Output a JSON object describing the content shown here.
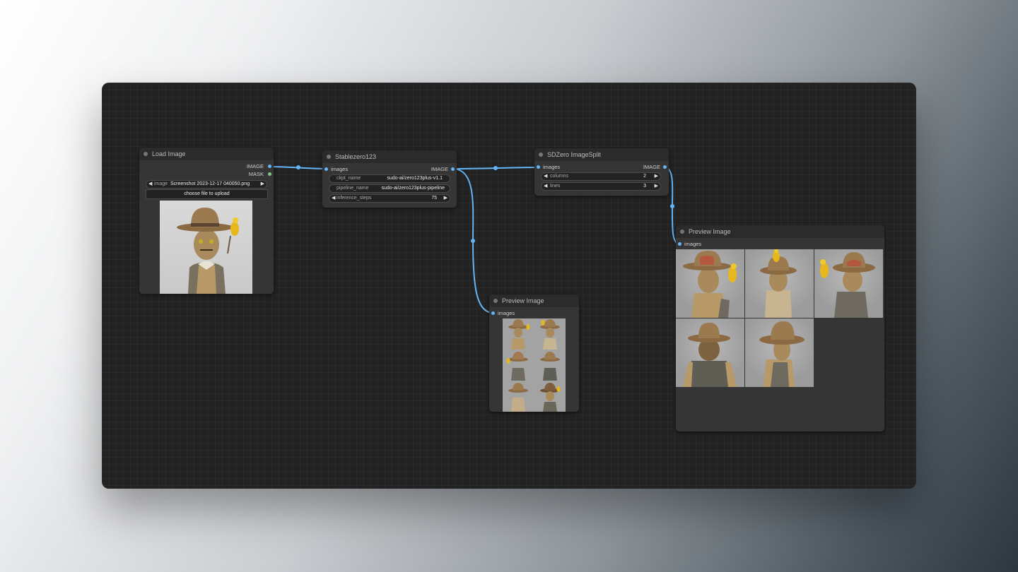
{
  "nodes": {
    "load_image": {
      "title": "Load Image",
      "outputs": [
        "IMAGE",
        "MASK"
      ],
      "image_widget": {
        "label": "image",
        "value": "Screenshot 2023-12-17 040050.png"
      },
      "upload_label": "choose file to upload"
    },
    "stablezero": {
      "title": "Stablezero123",
      "input": "images",
      "output": "IMAGE",
      "widgets": [
        {
          "label": "ckpt_name",
          "value": "sudo-ai/zero123plus-v1.1"
        },
        {
          "label": "pipeline_name",
          "value": "sudo-ai/zero123plus-pipeline"
        },
        {
          "label": "inference_steps",
          "value": "75"
        }
      ]
    },
    "imagesplit": {
      "title": "SDZero ImageSplit",
      "input": "images",
      "output": "IMAGE",
      "widgets": [
        {
          "label": "columns",
          "value": "2"
        },
        {
          "label": "lines",
          "value": "3"
        }
      ]
    },
    "preview_small": {
      "title": "Preview Image",
      "input": "images"
    },
    "preview_large": {
      "title": "Preview Image",
      "input": "images"
    }
  },
  "colors": {
    "wire": "#64b5f6",
    "mask_port": "#81c784",
    "node_bg": "#353535",
    "canvas_bg": "#222222"
  }
}
